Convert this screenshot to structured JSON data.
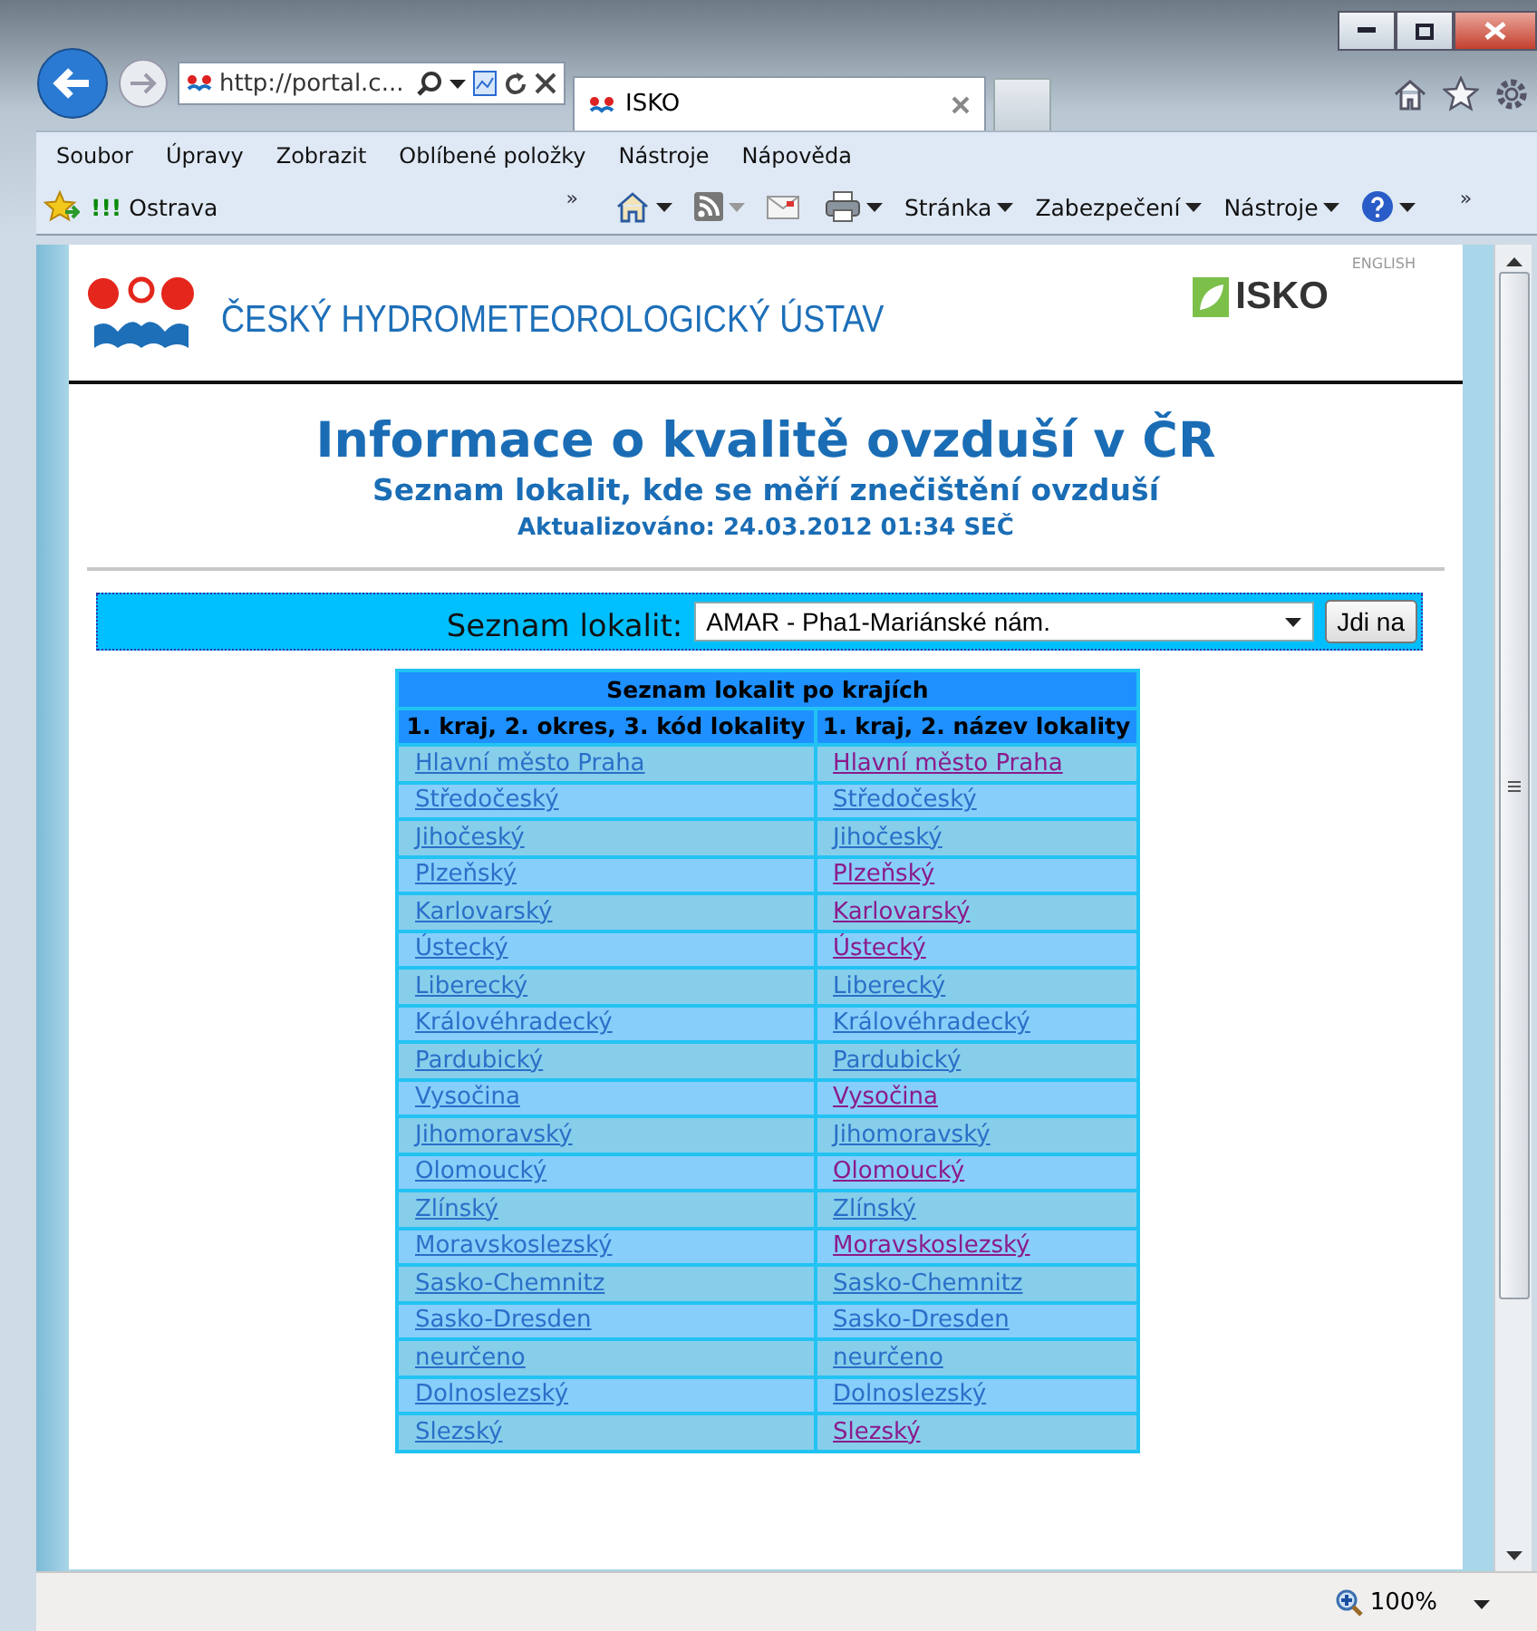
{
  "browser": {
    "address": "http://portal.c...",
    "tab_title": "ISKO",
    "menu": [
      "Soubor",
      "Úpravy",
      "Zobrazit",
      "Oblíbené položky",
      "Nástroje",
      "Nápověda"
    ],
    "favorite": {
      "mark": "!!!",
      "label": "Ostrava"
    },
    "chevron": "»",
    "commands": [
      "Stránka",
      "Zabezpečení",
      "Nástroje"
    ],
    "zoom": "100%"
  },
  "header": {
    "org": "ČESKÝ HYDROMETEOROLOGICKÝ ÚSTAV",
    "brand": "ISKO",
    "language_link": "ENGLISH"
  },
  "title": "Informace o kvalitě ovzduší v ČR",
  "subtitle": "Seznam lokalit, kde se měří znečištění ovzduší",
  "updated": "Aktualizováno: 24.03.2012 01:34 SEČ",
  "selector": {
    "label": "Seznam lokalit:",
    "value": "AMAR - Pha1-Mariánské nám.",
    "button": "Jdi na"
  },
  "table": {
    "caption": "Seznam lokalit po krajích",
    "columns": [
      "1. kraj, 2. okres, 3. kód lokality",
      "1. kraj, 2. název lokality"
    ],
    "rows": [
      {
        "cells": [
          {
            "text": "Hlavní město Praha",
            "visited": false
          },
          {
            "text": "Hlavní město Praha",
            "visited": true
          }
        ]
      },
      {
        "cells": [
          {
            "text": "Středočeský",
            "visited": false
          },
          {
            "text": "Středočeský",
            "visited": false
          }
        ]
      },
      {
        "cells": [
          {
            "text": "Jihočeský",
            "visited": false
          },
          {
            "text": "Jihočeský",
            "visited": false
          }
        ]
      },
      {
        "cells": [
          {
            "text": "Plzeňský",
            "visited": false
          },
          {
            "text": "Plzeňský",
            "visited": true
          }
        ]
      },
      {
        "cells": [
          {
            "text": "Karlovarský",
            "visited": false
          },
          {
            "text": "Karlovarský",
            "visited": true
          }
        ]
      },
      {
        "cells": [
          {
            "text": "Ústecký",
            "visited": false
          },
          {
            "text": "Ústecký",
            "visited": true
          }
        ]
      },
      {
        "cells": [
          {
            "text": "Liberecký",
            "visited": false
          },
          {
            "text": "Liberecký",
            "visited": false
          }
        ]
      },
      {
        "cells": [
          {
            "text": "Královéhradecký",
            "visited": false
          },
          {
            "text": "Královéhradecký",
            "visited": false
          }
        ]
      },
      {
        "cells": [
          {
            "text": "Pardubický",
            "visited": false
          },
          {
            "text": "Pardubický",
            "visited": false
          }
        ]
      },
      {
        "cells": [
          {
            "text": "Vysočina",
            "visited": false
          },
          {
            "text": "Vysočina",
            "visited": true
          }
        ]
      },
      {
        "cells": [
          {
            "text": "Jihomoravský",
            "visited": false
          },
          {
            "text": "Jihomoravský",
            "visited": false
          }
        ]
      },
      {
        "cells": [
          {
            "text": "Olomoucký",
            "visited": false
          },
          {
            "text": "Olomoucký",
            "visited": true
          }
        ]
      },
      {
        "cells": [
          {
            "text": "Zlínský",
            "visited": false
          },
          {
            "text": "Zlínský",
            "visited": false
          }
        ]
      },
      {
        "cells": [
          {
            "text": "Moravskoslezský",
            "visited": false
          },
          {
            "text": "Moravskoslezský",
            "visited": true
          }
        ]
      },
      {
        "cells": [
          {
            "text": "Sasko-Chemnitz",
            "visited": false
          },
          {
            "text": "Sasko-Chemnitz",
            "visited": false
          }
        ]
      },
      {
        "cells": [
          {
            "text": "Sasko-Dresden",
            "visited": false
          },
          {
            "text": "Sasko-Dresden",
            "visited": false
          }
        ]
      },
      {
        "cells": [
          {
            "text": "neurčeno",
            "visited": false
          },
          {
            "text": "neurčeno",
            "visited": false
          }
        ]
      },
      {
        "cells": [
          {
            "text": "Dolnoslezský",
            "visited": false
          },
          {
            "text": "Dolnoslezský",
            "visited": false
          }
        ]
      },
      {
        "cells": [
          {
            "text": "Slezský",
            "visited": false
          },
          {
            "text": "Slezský",
            "visited": true
          }
        ]
      }
    ]
  }
}
